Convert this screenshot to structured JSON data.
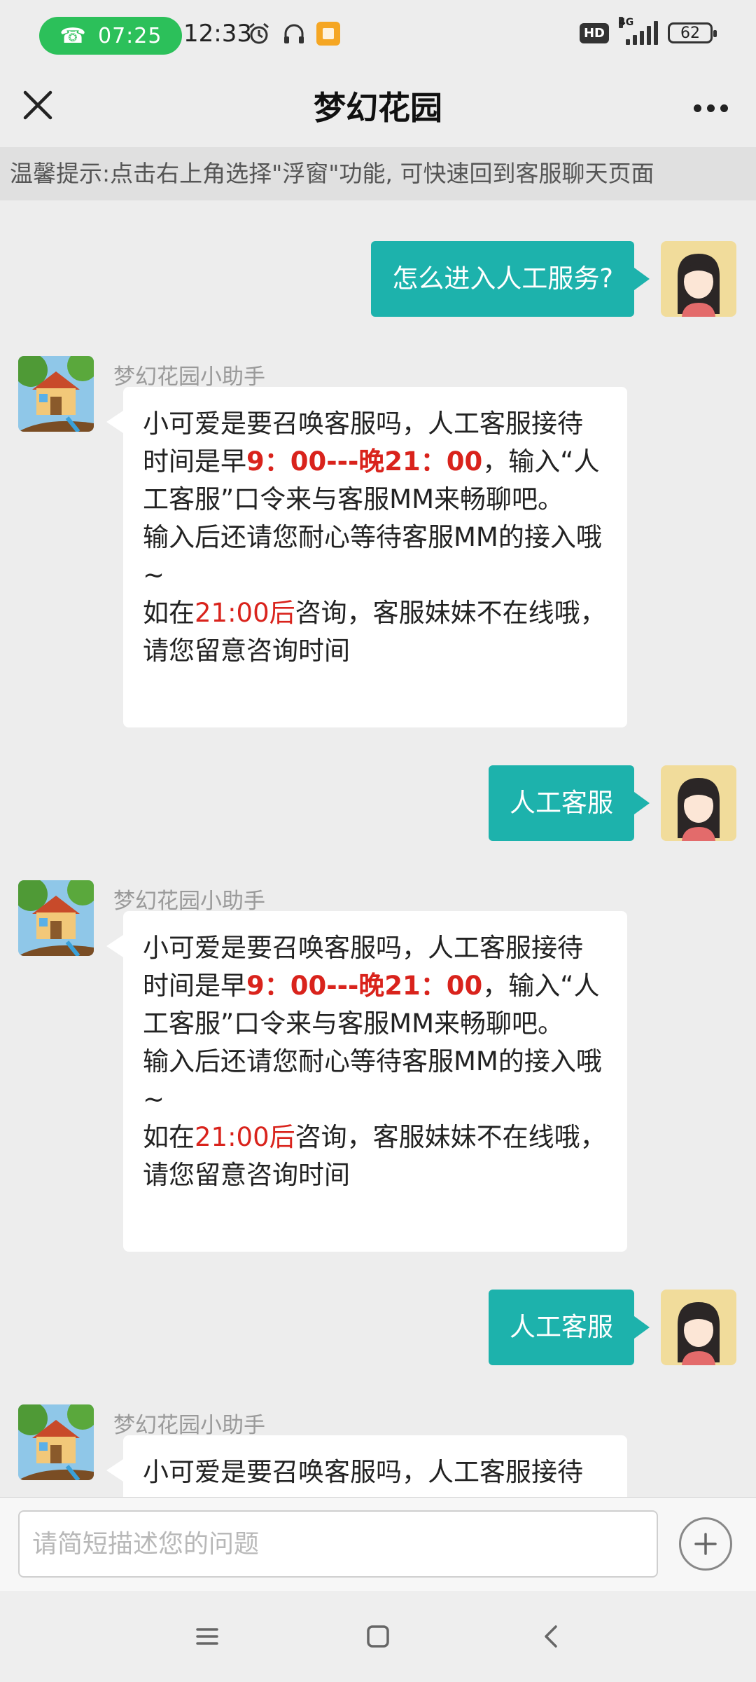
{
  "status_bar": {
    "call_timer": "07:25",
    "clock": "12:33",
    "hd_label": "HD",
    "network": "4G",
    "battery": "62"
  },
  "header": {
    "title": "梦幻花园"
  },
  "tip": "温馨提示:点击右上角选择\"浮窗\"功能, 可快速回到客服聊天页面",
  "messages": [
    {
      "from": "user",
      "text": "怎么进入人工服务?"
    },
    {
      "from": "bot",
      "name": "梦幻花园小助手",
      "p1_a": "小可爱是要召唤客服吗，人工客服接待时间是早",
      "p1_hours": "9：00---晚21：00",
      "p1_b": "，输入“人工客服”口令来与客服MM来畅聊吧。",
      "p2": "输入后还请您耐心等待客服MM的接入哦~",
      "p3_a": "如在",
      "p3_time": "21:00后",
      "p3_b": "咨询，客服妹妹不在线哦，请您留意咨询时间"
    },
    {
      "from": "user",
      "text": "人工客服"
    },
    {
      "from": "bot",
      "name": "梦幻花园小助手",
      "p1_a": "小可爱是要召唤客服吗，人工客服接待时间是早",
      "p1_hours": "9：00---晚21：00",
      "p1_b": "，输入“人工客服”口令来与客服MM来畅聊吧。",
      "p2": "输入后还请您耐心等待客服MM的接入哦~",
      "p3_a": "如在",
      "p3_time": "21:00后",
      "p3_b": "咨询，客服妹妹不在线哦，请您留意咨询时间"
    },
    {
      "from": "user",
      "text": "人工客服"
    },
    {
      "from": "bot",
      "name": "梦幻花园小助手",
      "p1_a": "小可爱是要召唤客服吗，人工客服接待"
    }
  ],
  "input": {
    "placeholder": "请简短描述您的问题"
  },
  "colors": {
    "user_bubble": "#1db2ac",
    "highlight_red": "#d9231c",
    "call_pill": "#2cc05a"
  },
  "icons": [
    "phone-icon",
    "alarm-icon",
    "headphones-icon",
    "photo-icon",
    "close-icon",
    "more-icon",
    "plus-icon",
    "menu-icon",
    "home-icon",
    "back-icon"
  ]
}
